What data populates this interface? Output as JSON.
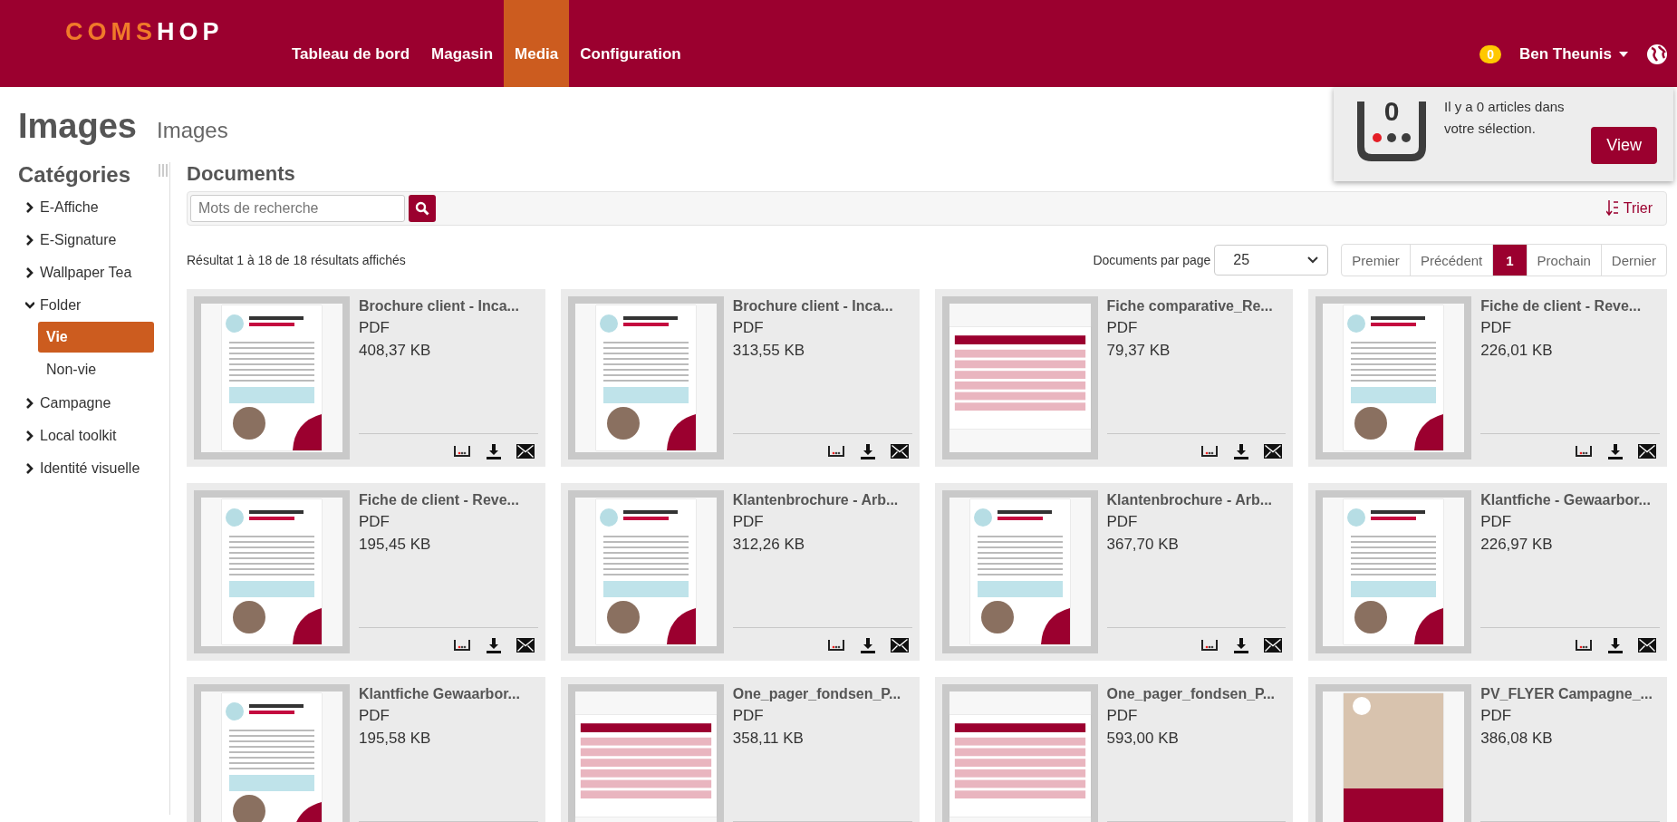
{
  "header": {
    "logo": "COMSHOP",
    "nav": [
      {
        "label": "Tableau de bord",
        "selected": false
      },
      {
        "label": "Magasin",
        "selected": false
      },
      {
        "label": "Media",
        "selected": true
      },
      {
        "label": "Configuration",
        "selected": false
      }
    ],
    "cart_badge": "0",
    "user": "Ben Theunis"
  },
  "selection_popup": {
    "count": "0",
    "message": "Il y a 0 articles dans votre sélection.",
    "button": "View"
  },
  "page": {
    "title": "Images",
    "subtitle": "Images"
  },
  "sidebar": {
    "title": "Catégories",
    "items": [
      {
        "label": "E-Affiche",
        "expanded": false
      },
      {
        "label": "E-Signature",
        "expanded": false
      },
      {
        "label": "Wallpaper Tea",
        "expanded": false
      },
      {
        "label": "Folder",
        "expanded": true,
        "children": [
          {
            "label": "Vie",
            "selected": true
          },
          {
            "label": "Non-vie",
            "selected": false
          }
        ]
      },
      {
        "label": "Campagne",
        "expanded": false
      },
      {
        "label": "Local toolkit",
        "expanded": false
      },
      {
        "label": "Identité visuelle",
        "expanded": false
      }
    ]
  },
  "documents": {
    "title": "Documents",
    "search": {
      "placeholder": "Mots de recherche"
    },
    "sort": "Trier",
    "result_text": "Résultat 1 à 18 de 18 résultats affichés",
    "per_page_label": "Documents par page",
    "per_page": "25",
    "pagination": [
      {
        "label": "Premier",
        "selected": false
      },
      {
        "label": "Précédent",
        "selected": false
      },
      {
        "label": "1",
        "selected": true
      },
      {
        "label": "Prochain",
        "selected": false
      },
      {
        "label": "Dernier",
        "selected": false
      }
    ],
    "items": [
      {
        "title": "Brochure client - Inca...",
        "type": "PDF",
        "size": "408,37 KB",
        "kind": "portrait"
      },
      {
        "title": "Brochure client - Inca...",
        "type": "PDF",
        "size": "313,55 KB",
        "kind": "portrait"
      },
      {
        "title": "Fiche comparative_Re...",
        "type": "PDF",
        "size": "79,37 KB",
        "kind": "landscape"
      },
      {
        "title": "Fiche de client - Reve...",
        "type": "PDF",
        "size": "226,01 KB",
        "kind": "portrait"
      },
      {
        "title": "Fiche de client - Reve...",
        "type": "PDF",
        "size": "195,45 KB",
        "kind": "portrait"
      },
      {
        "title": "Klantenbrochure - Arb...",
        "type": "PDF",
        "size": "312,26 KB",
        "kind": "portrait"
      },
      {
        "title": "Klantenbrochure - Arb...",
        "type": "PDF",
        "size": "367,70 KB",
        "kind": "portrait"
      },
      {
        "title": "Klantfiche - Gewaarbor...",
        "type": "PDF",
        "size": "226,97 KB",
        "kind": "portrait"
      },
      {
        "title": "Klantfiche Gewaarbor...",
        "type": "PDF",
        "size": "195,58 KB",
        "kind": "portrait"
      },
      {
        "title": "One_pager_fondsen_P...",
        "type": "PDF",
        "size": "358,11 KB",
        "kind": "landscape"
      },
      {
        "title": "One_pager_fondsen_P...",
        "type": "PDF",
        "size": "593,00 KB",
        "kind": "landscape"
      },
      {
        "title": "PV_FLYER Campagne_...",
        "type": "PDF",
        "size": "386,08 KB",
        "kind": "photo"
      }
    ]
  }
}
